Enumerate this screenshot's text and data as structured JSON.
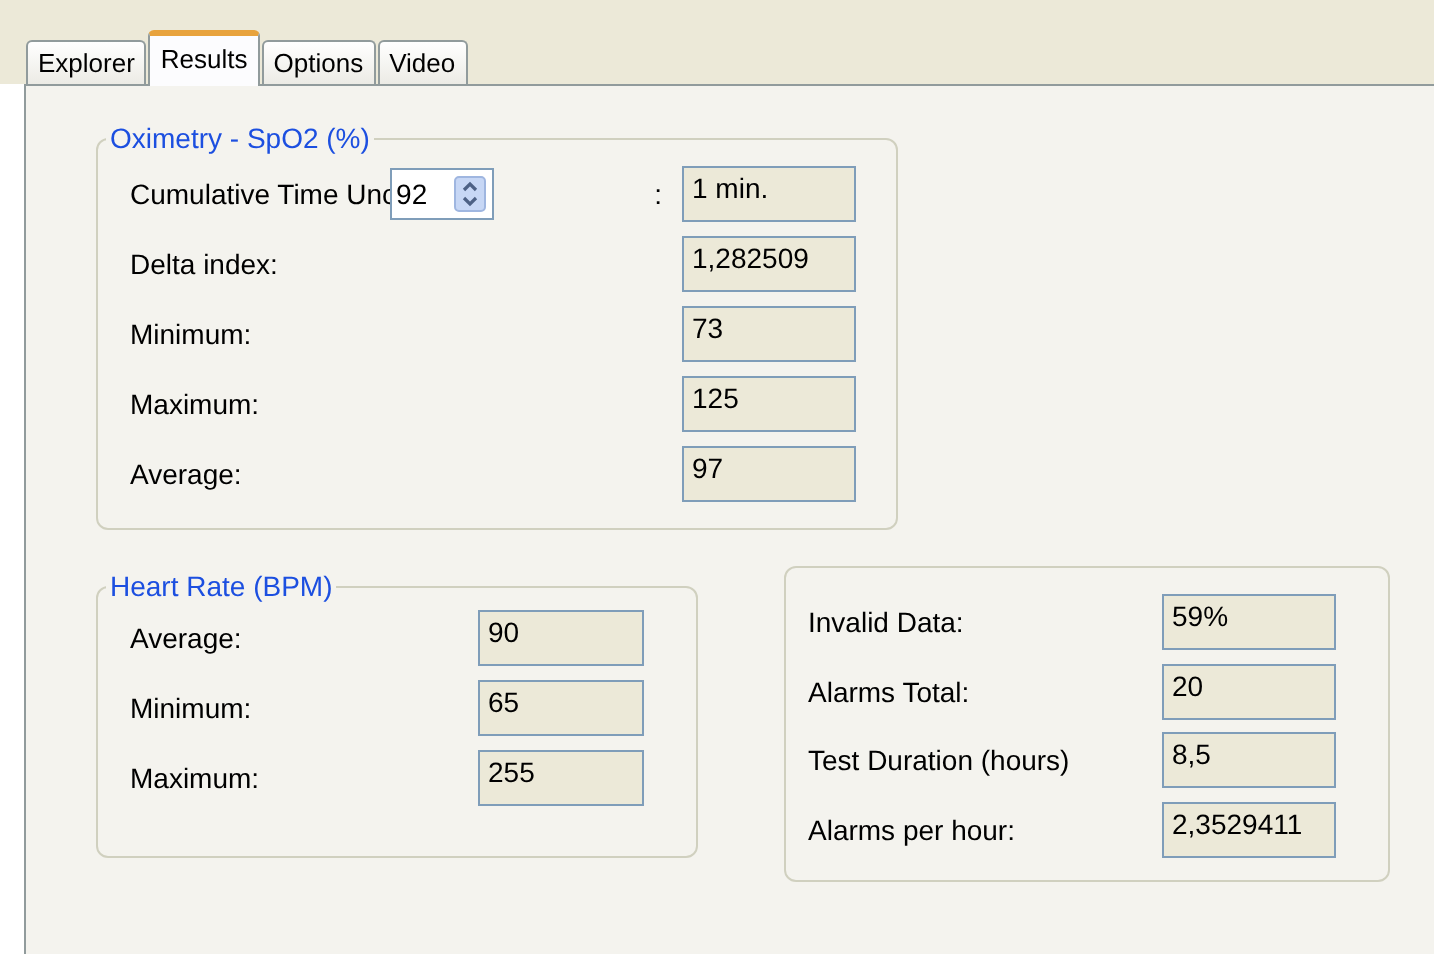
{
  "tabs": [
    {
      "label": "Explorer",
      "selected": false
    },
    {
      "label": "Results",
      "selected": true
    },
    {
      "label": "Options",
      "selected": false
    },
    {
      "label": "Video",
      "selected": false
    }
  ],
  "oximetry": {
    "title": "Oximetry - SpO2 (%)",
    "rows": [
      {
        "kind": "spinner",
        "label": "Cumulative Time Unc",
        "spinner": "92",
        "separator": ":",
        "value": "1 min."
      },
      {
        "kind": "plain",
        "label": "Delta index:",
        "value": "1,282509"
      },
      {
        "kind": "plain",
        "label": "Minimum:",
        "value": "73"
      },
      {
        "kind": "plain",
        "label": "Maximum:",
        "value": "125"
      },
      {
        "kind": "plain",
        "label": "Average:",
        "value": "97"
      }
    ]
  },
  "heart_rate": {
    "title": "Heart Rate (BPM)",
    "rows": [
      {
        "label": "Average:",
        "value": "90"
      },
      {
        "label": "Minimum:",
        "value": "65"
      },
      {
        "label": "Maximum:",
        "value": "255"
      }
    ]
  },
  "summary": {
    "rows": [
      {
        "label": "Invalid Data:",
        "value": "59%"
      },
      {
        "label": "Alarms Total:",
        "value": "20"
      },
      {
        "label": "Test Duration (hours)",
        "value": "8,5"
      },
      {
        "label": "Alarms per hour:",
        "value": "2,3529411"
      }
    ]
  }
}
